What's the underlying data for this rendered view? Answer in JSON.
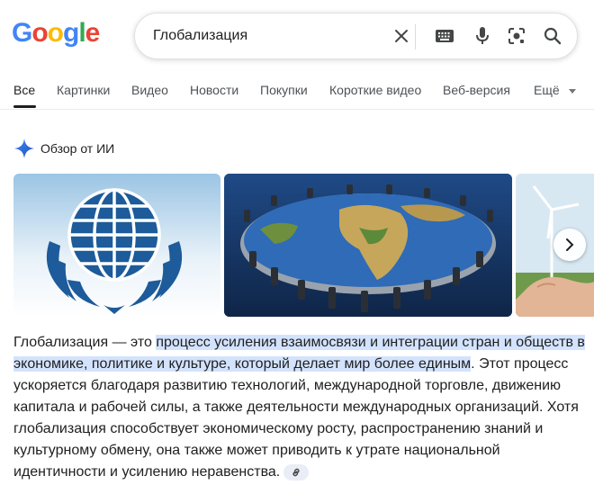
{
  "logo": {
    "letters": [
      "G",
      "o",
      "o",
      "g",
      "l",
      "e"
    ],
    "colors": [
      "#4285F4",
      "#EA4335",
      "#FBBC05",
      "#4285F4",
      "#34A853",
      "#EA4335"
    ]
  },
  "search": {
    "query": "Глобализация",
    "icons": [
      "close-icon",
      "keyboard-icon",
      "mic-icon",
      "lens-icon",
      "search-icon"
    ]
  },
  "tabs": [
    {
      "label": "Все"
    },
    {
      "label": "Картинки"
    },
    {
      "label": "Видео"
    },
    {
      "label": "Новости"
    },
    {
      "label": "Покупки"
    },
    {
      "label": "Короткие видео"
    },
    {
      "label": "Веб-версия"
    },
    {
      "label": "Ещё"
    }
  ],
  "ai_overview": {
    "title": "Обзор от ИИ",
    "images": [
      "un-globe-logo",
      "world-map-table",
      "wind-turbines-hand"
    ],
    "text_prefix": "Глобализация — это ",
    "text_highlight": "процесс усиления взаимосвязи и интеграции стран и обществ в экономике, политике и культуре, который делает мир более единым",
    "text_rest": ". Этот процесс ускоряется благодаря развитию технологий, международной торговле, движению капитала и рабочей силы, а также деятельности международных организаций. Хотя глобализация способствует экономическому росту, распространению знаний и культурному обмену, она также может приводить к утрате национальной идентичности и усилению неравенства."
  },
  "colors": {
    "accent": "#1a73e8",
    "highlight": "#d3e3fd",
    "tab_text": "#4d5156"
  }
}
